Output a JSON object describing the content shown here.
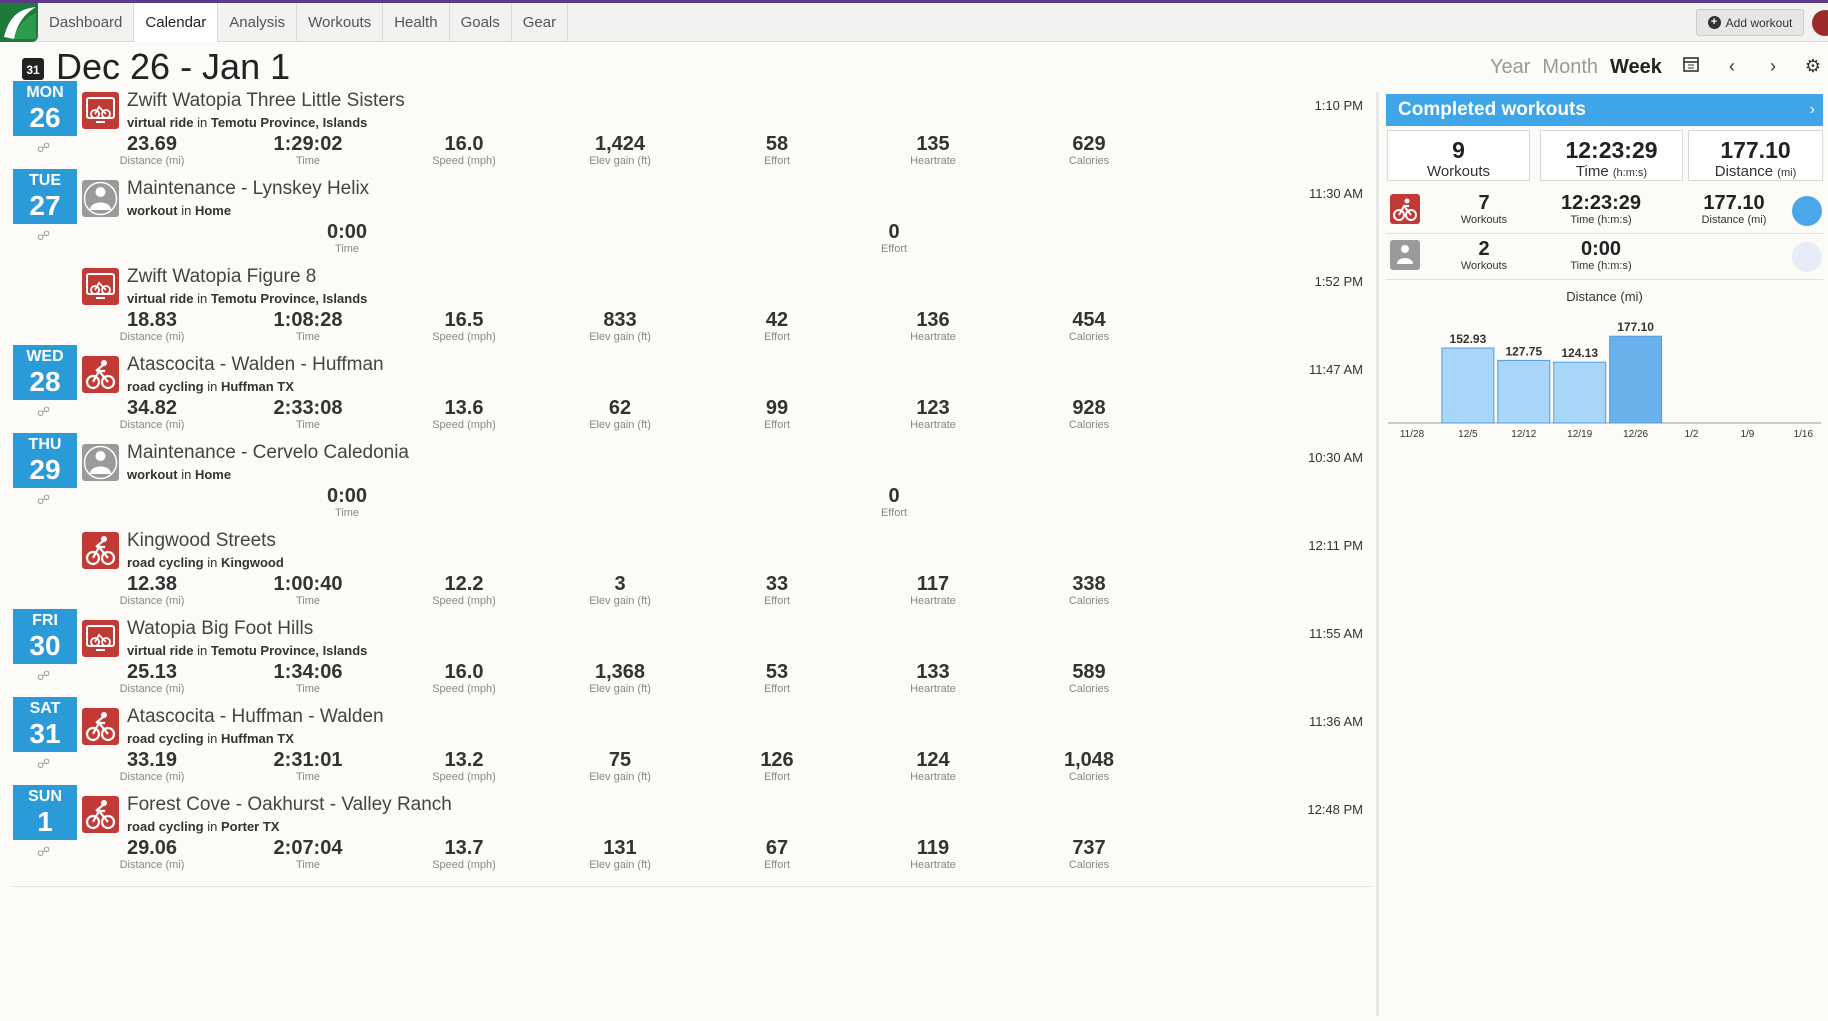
{
  "nav": {
    "tabs": [
      "Dashboard",
      "Calendar",
      "Analysis",
      "Workouts",
      "Health",
      "Goals",
      "Gear"
    ],
    "active_tab": "Calendar",
    "add_workout_label": "Add workout"
  },
  "header": {
    "calendar_icon_text": "31",
    "title": "Dec 26 - Jan 1",
    "views": [
      "Year",
      "Month",
      "Week"
    ],
    "active_view": "Week"
  },
  "stat_labels": {
    "distance": "Distance (mi)",
    "time": "Time",
    "speed": "Speed (mph)",
    "elev": "Elev gain (ft)",
    "effort": "Effort",
    "heartrate": "Heartrate",
    "calories": "Calories"
  },
  "workouts": [
    {
      "day_name": "MON",
      "day_num": "26",
      "title": "Zwift Watopia Three Little Sisters",
      "type": "virtual ride",
      "location": "Temotu Province, Islands",
      "start": "1:10 PM",
      "icon": "virtual-ride-icon",
      "distance": "23.69",
      "time": "1:29:02",
      "speed": "16.0",
      "elev": "1,424",
      "effort": "58",
      "heartrate": "135",
      "calories": "629"
    },
    {
      "day_name": "TUE",
      "day_num": "27",
      "title": "Maintenance - Lynskey Helix",
      "type": "workout",
      "location": "Home",
      "start": "11:30 AM",
      "icon": "maintenance-icon",
      "time": "0:00",
      "effort": "0"
    },
    {
      "title": "Zwift Watopia Figure 8",
      "type": "virtual ride",
      "location": "Temotu Province, Islands",
      "start": "1:52 PM",
      "icon": "virtual-ride-icon",
      "distance": "18.83",
      "time": "1:08:28",
      "speed": "16.5",
      "elev": "833",
      "effort": "42",
      "heartrate": "136",
      "calories": "454"
    },
    {
      "day_name": "WED",
      "day_num": "28",
      "title": "Atascocita - Walden - Huffman",
      "type": "road cycling",
      "location": "Huffman TX",
      "start": "11:47 AM",
      "icon": "road-cycling-icon",
      "distance": "34.82",
      "time": "2:33:08",
      "speed": "13.6",
      "elev": "62",
      "effort": "99",
      "heartrate": "123",
      "calories": "928"
    },
    {
      "day_name": "THU",
      "day_num": "29",
      "title": "Maintenance - Cervelo Caledonia",
      "type": "workout",
      "location": "Home",
      "start": "10:30 AM",
      "icon": "maintenance-icon",
      "time": "0:00",
      "effort": "0"
    },
    {
      "title": "Kingwood Streets",
      "type": "road cycling",
      "location": "Kingwood",
      "start": "12:11 PM",
      "icon": "road-cycling-icon",
      "distance": "12.38",
      "time": "1:00:40",
      "speed": "12.2",
      "elev": "3",
      "effort": "33",
      "heartrate": "117",
      "calories": "338"
    },
    {
      "day_name": "FRI",
      "day_num": "30",
      "title": "Watopia Big Foot Hills",
      "type": "virtual ride",
      "location": "Temotu Province, Islands",
      "start": "11:55 AM",
      "icon": "virtual-ride-icon",
      "distance": "25.13",
      "time": "1:34:06",
      "speed": "16.0",
      "elev": "1,368",
      "effort": "53",
      "heartrate": "133",
      "calories": "589"
    },
    {
      "day_name": "SAT",
      "day_num": "31",
      "title": "Atascocita - Huffman - Walden",
      "type": "road cycling",
      "location": "Huffman TX",
      "start": "11:36 AM",
      "icon": "road-cycling-icon",
      "distance": "33.19",
      "time": "2:31:01",
      "speed": "13.2",
      "elev": "75",
      "effort": "126",
      "heartrate": "124",
      "calories": "1,048"
    },
    {
      "day_name": "SUN",
      "day_num": "1",
      "title": "Forest Cove - Oakhurst - Valley Ranch",
      "type": "road cycling",
      "location": "Porter TX",
      "start": "12:48 PM",
      "icon": "road-cycling-icon",
      "distance": "29.06",
      "time": "2:07:04",
      "speed": "13.7",
      "elev": "131",
      "effort": "67",
      "heartrate": "119",
      "calories": "737"
    }
  ],
  "panel": {
    "title": "Completed workouts",
    "totals": {
      "workouts": "9",
      "workouts_label": "Workouts",
      "time": "12:23:29",
      "time_label": "Time",
      "time_unit": "(h:m:s)",
      "distance": "177.10",
      "distance_label": "Distance",
      "distance_unit": "(mi)"
    },
    "by_type": [
      {
        "icon": "cycling-icon",
        "workouts": "7",
        "workouts_label": "Workouts",
        "time": "12:23:29",
        "time_label": "Time (h:m:s)",
        "distance": "177.10",
        "distance_label": "Distance (mi)",
        "color": "#4aa8ea"
      },
      {
        "icon": "maintenance-icon",
        "workouts": "2",
        "workouts_label": "Workouts",
        "time": "0:00",
        "time_label": "Time (h:m:s)",
        "color": "#e8ecf8"
      }
    ],
    "in_word": "in"
  },
  "chart_data": {
    "type": "bar",
    "title": "Distance (mi)",
    "categories": [
      "11/28",
      "12/5",
      "12/12",
      "12/19",
      "12/26",
      "1/2",
      "1/9",
      "1/16"
    ],
    "values": [
      null,
      152.93,
      127.75,
      124.13,
      177.1,
      null,
      null,
      null
    ],
    "value_labels": [
      "",
      "152.93",
      "127.75",
      "124.13",
      "177.10",
      "",
      "",
      ""
    ],
    "highlight_index": 4,
    "ylim": [
      0,
      200
    ],
    "colors": {
      "bar": "#a8d6f8",
      "highlight": "#69b1ea",
      "border": "#4e9ee0"
    }
  }
}
